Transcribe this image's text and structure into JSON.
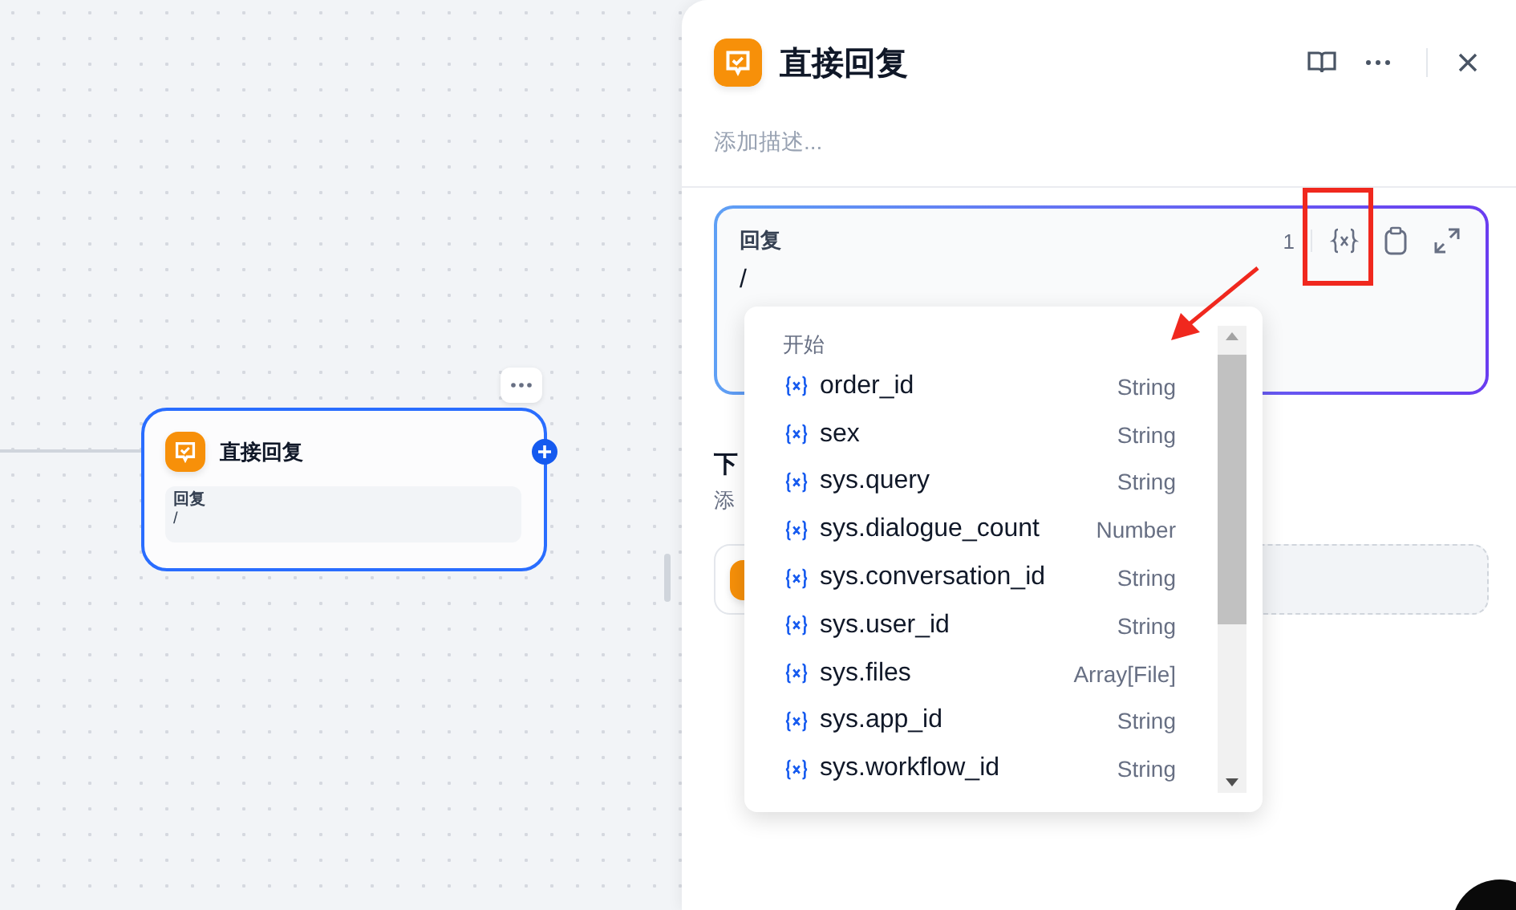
{
  "canvas": {
    "node": {
      "title": "直接回复",
      "field_label": "回复",
      "field_value": "/"
    }
  },
  "panel": {
    "title": "直接回复",
    "description": {
      "placeholder": "添加描述..."
    },
    "reply": {
      "label": "回复",
      "count": "1",
      "value": "/"
    },
    "next_step": {
      "title": "下",
      "hint": "添"
    }
  },
  "variable_menu": {
    "group": "开始",
    "items": [
      {
        "name": "order_id",
        "type": "String"
      },
      {
        "name": "sex",
        "type": "String"
      },
      {
        "name": "sys.query",
        "type": "String"
      },
      {
        "name": "sys.dialogue_count",
        "type": "Number"
      },
      {
        "name": "sys.conversation_id",
        "type": "String"
      },
      {
        "name": "sys.user_id",
        "type": "String"
      },
      {
        "name": "sys.files",
        "type": "Array[File]"
      },
      {
        "name": "sys.app_id",
        "type": "String"
      },
      {
        "name": "sys.workflow_id",
        "type": "String"
      }
    ]
  }
}
